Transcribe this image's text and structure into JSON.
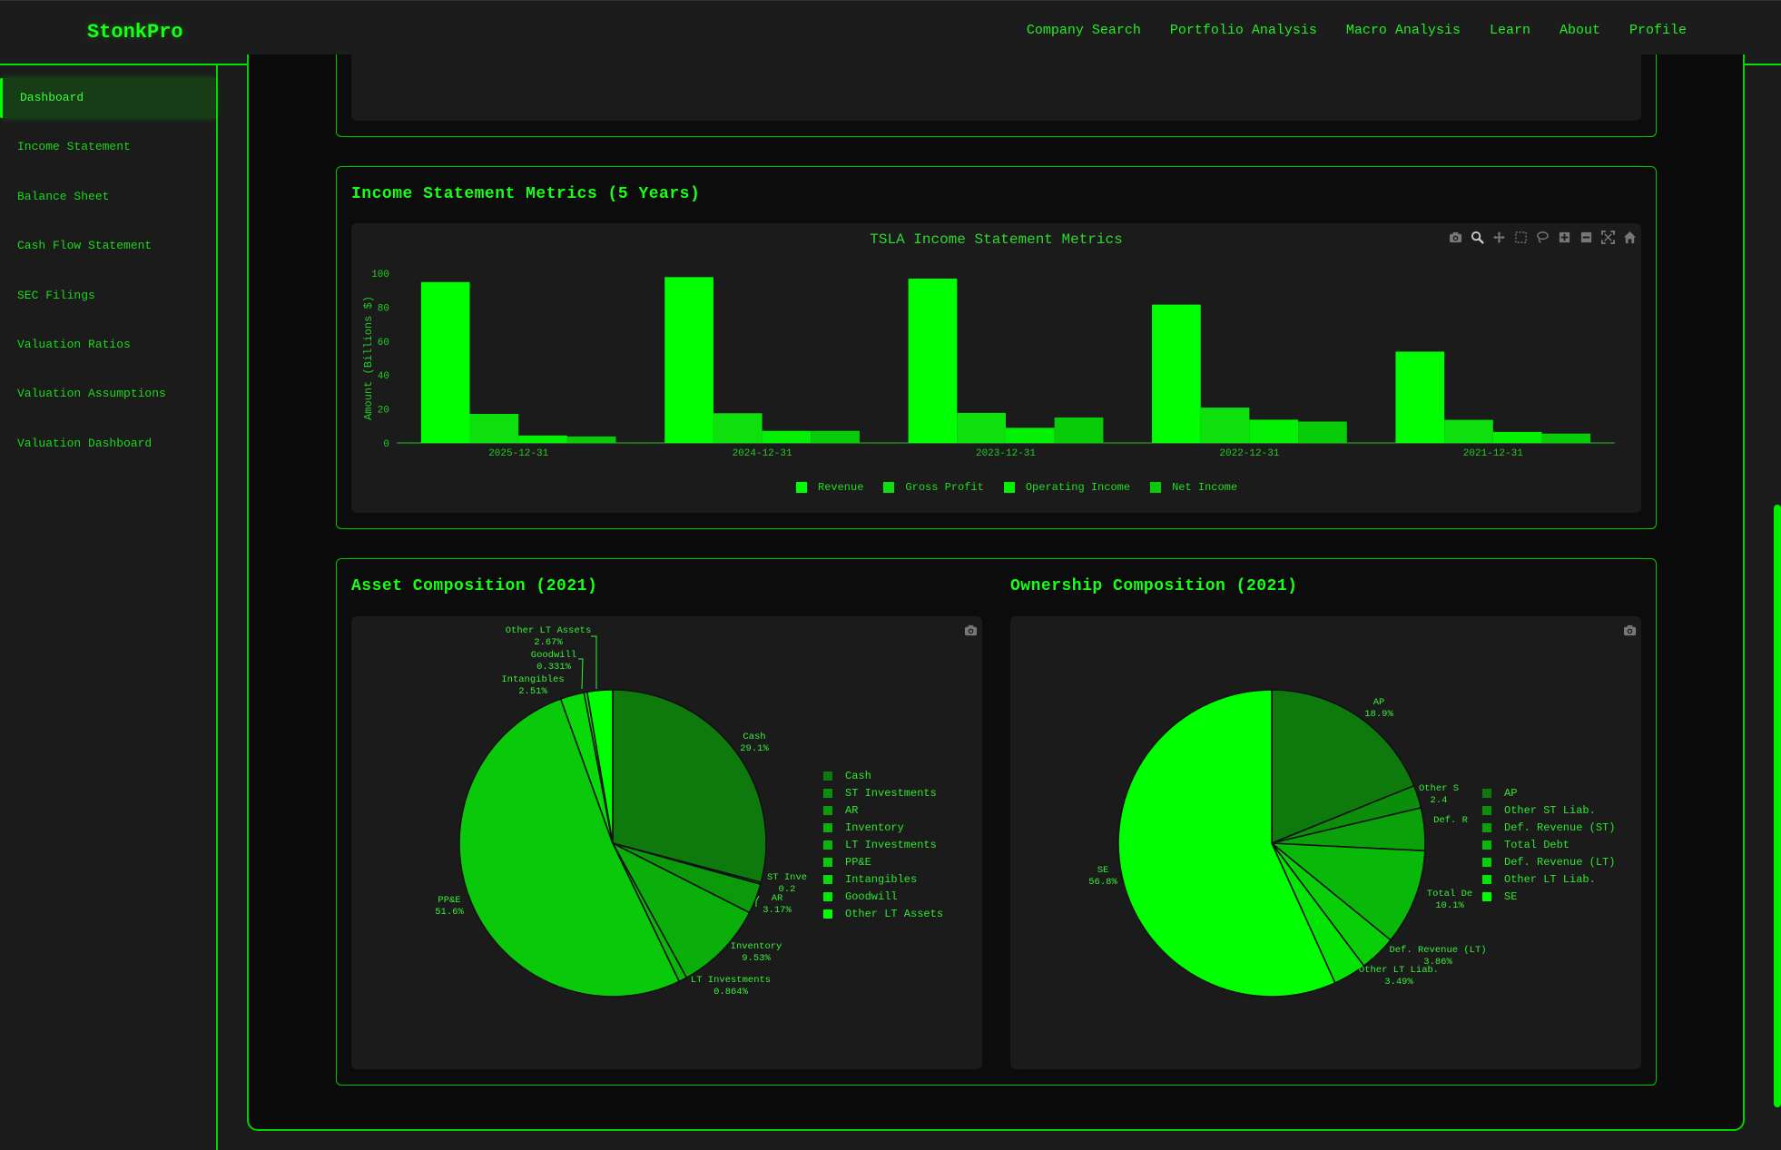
{
  "app": {
    "brand": "StonkPro"
  },
  "nav": [
    {
      "key": "company-search",
      "label": "Company Search"
    },
    {
      "key": "portfolio-analysis",
      "label": "Portfolio Analysis"
    },
    {
      "key": "macro-analysis",
      "label": "Macro Analysis"
    },
    {
      "key": "learn",
      "label": "Learn"
    },
    {
      "key": "about",
      "label": "About"
    },
    {
      "key": "profile",
      "label": "Profile"
    }
  ],
  "sidebar": {
    "active": "Dashboard",
    "items": [
      "Dashboard",
      "Income Statement",
      "Balance Sheet",
      "Cash Flow Statement",
      "SEC Filings",
      "Valuation Ratios",
      "Valuation Assumptions",
      "Valuation Dashboard"
    ]
  },
  "icons": {
    "toolbar": [
      "camera-icon",
      "zoom-icon",
      "pan-icon",
      "box-select-icon",
      "lasso-select-icon",
      "zoom-in-icon",
      "zoom-out-icon",
      "autoscale-icon",
      "reset-axes-icon"
    ],
    "pie_toolbar": [
      "camera-icon"
    ]
  },
  "colors": {
    "accent": "#00ff00",
    "background": "#1b1b1b",
    "panel": "#0c0c0c",
    "series": [
      "#00ff00",
      "#0ee00e",
      "#04f004",
      "#07cc07"
    ],
    "asset_slices": [
      "#0e7a0e",
      "#0b8f0b",
      "#0a9a0a",
      "#0aaf0a",
      "#0bb50b",
      "#0ac90a",
      "#09d809",
      "#06e806",
      "#00ff00"
    ],
    "owner_slices": [
      "#0e7a0e",
      "#0b8f0b",
      "#0aa10a",
      "#09b909",
      "#08cf08",
      "#05e505",
      "#00ff00"
    ]
  },
  "income": {
    "card_title": "Income Statement Metrics (5 Years)",
    "chart_title": "TSLA Income Statement Metrics"
  },
  "assets": {
    "card_title": "Asset Composition (2021)"
  },
  "ownership": {
    "card_title": "Ownership Composition (2021)"
  },
  "chart_data": [
    {
      "type": "bar",
      "title": "TSLA Income Statement Metrics",
      "xlabel": "",
      "ylabel": "Amount (Billions $)",
      "ylim": [
        0,
        100
      ],
      "yticks": [
        0,
        20,
        40,
        60,
        80,
        100
      ],
      "categories": [
        "2025-12-31",
        "2024-12-31",
        "2023-12-31",
        "2022-12-31",
        "2021-12-31"
      ],
      "series": [
        {
          "name": "Revenue",
          "values": [
            94.8,
            97.7,
            96.8,
            81.5,
            53.8
          ]
        },
        {
          "name": "Gross Profit",
          "values": [
            17.1,
            17.5,
            17.7,
            20.8,
            13.6
          ]
        },
        {
          "name": "Operating Income",
          "values": [
            4.4,
            7.1,
            8.9,
            13.7,
            6.5
          ]
        },
        {
          "name": "Net Income",
          "values": [
            3.8,
            7.1,
            15.0,
            12.6,
            5.5
          ]
        }
      ],
      "legend": "bottom",
      "grid": false
    },
    {
      "type": "pie",
      "title": "",
      "labels": [
        "Cash",
        "ST Investments",
        "AR",
        "Inventory",
        "LT Investments",
        "PP&E",
        "Intangibles",
        "Goodwill",
        "Other LT Assets"
      ],
      "values": [
        29.1,
        0.2,
        3.17,
        9.53,
        0.864,
        51.6,
        2.51,
        0.331,
        2.67
      ],
      "slice_labels": [
        "Cash\n29.1%",
        "ST Inve\n0.2",
        "AR\n3.17%",
        "Inventory\n9.53%",
        "LT Investments\n0.864%",
        "PP&E\n51.6%",
        "Intangibles\n2.51%",
        "Goodwill\n0.331%",
        "Other LT Assets\n2.67%"
      ],
      "legend": "right"
    },
    {
      "type": "pie",
      "title": "",
      "labels": [
        "AP",
        "Other ST Liab.",
        "Def. Revenue (ST)",
        "Total Debt",
        "Def. Revenue (LT)",
        "Other LT Liab.",
        "SE"
      ],
      "values": [
        18.9,
        2.4,
        4.5,
        10.1,
        3.86,
        3.49,
        56.8
      ],
      "slice_labels": [
        "AP\n18.9%",
        "Other S\n2.4",
        "Def. R",
        "Total De\n10.1%",
        "Def. Revenue (LT)\n3.86%",
        "Other LT Liab.\n3.49%",
        "SE\n56.8%"
      ],
      "legend": "right"
    }
  ]
}
